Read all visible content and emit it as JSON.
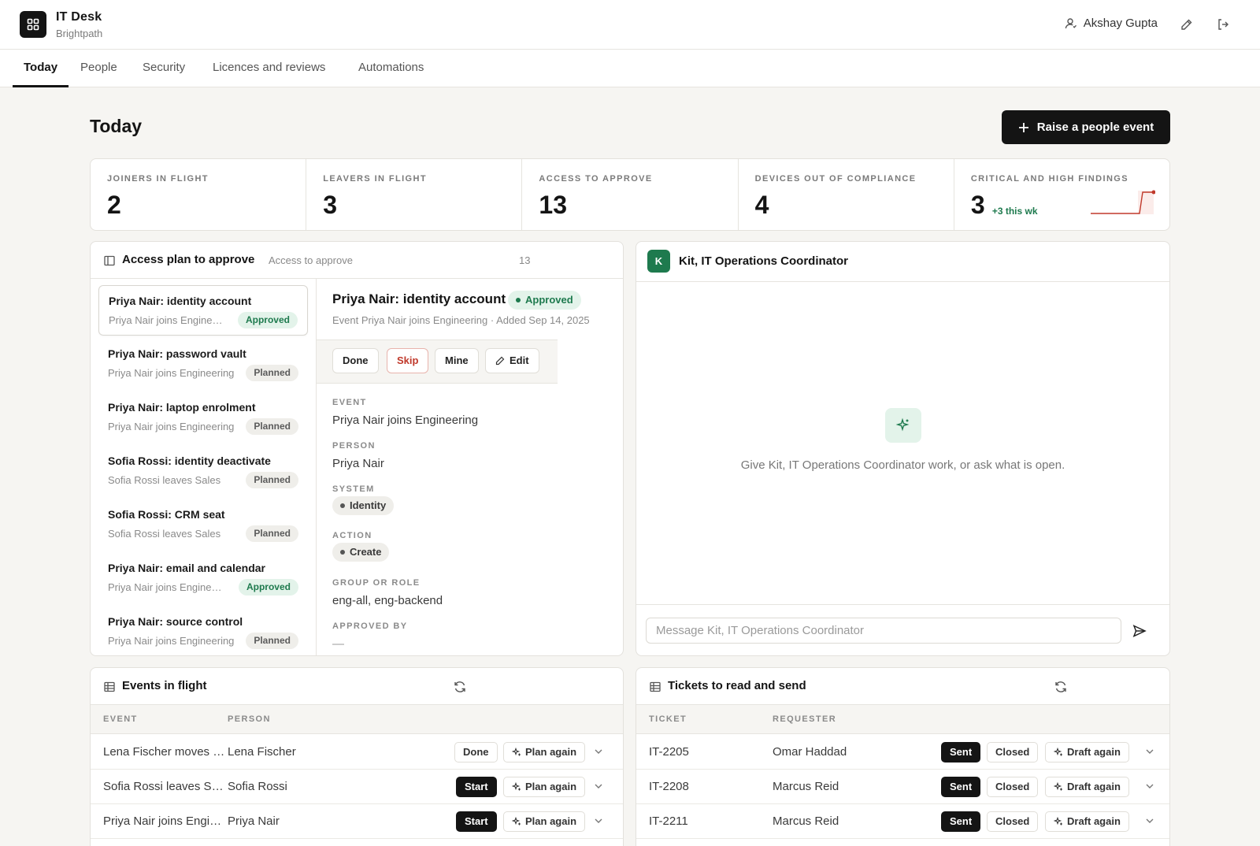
{
  "app": {
    "title": "IT Desk",
    "subtitle": "Brightpath"
  },
  "user": {
    "name": "Akshay Gupta"
  },
  "tabs": [
    {
      "label": "Today"
    },
    {
      "label": "People"
    },
    {
      "label": "Security"
    },
    {
      "label": "Licences and reviews"
    },
    {
      "label": "Automations"
    }
  ],
  "page": {
    "title": "Today",
    "primary_action": "Raise a people event"
  },
  "stats": [
    {
      "label": "JOINERS IN FLIGHT",
      "value": "2"
    },
    {
      "label": "LEAVERS IN FLIGHT",
      "value": "3"
    },
    {
      "label": "ACCESS TO APPROVE",
      "value": "13"
    },
    {
      "label": "DEVICES OUT OF COMPLIANCE",
      "value": "4"
    },
    {
      "label": "CRITICAL AND HIGH FINDINGS",
      "value": "3",
      "delta": "+3 this wk"
    }
  ],
  "access_plan": {
    "title": "Access plan to approve",
    "subtitle": "Access to approve",
    "count": "13",
    "items": [
      {
        "title": "Priya Nair: identity account",
        "sub": "Priya Nair joins Engineering",
        "status": "Approved",
        "kind": "approved"
      },
      {
        "title": "Priya Nair: password vault",
        "sub": "Priya Nair joins Engineering",
        "status": "Planned",
        "kind": "planned"
      },
      {
        "title": "Priya Nair: laptop enrolment",
        "sub": "Priya Nair joins Engineering",
        "status": "Planned",
        "kind": "planned"
      },
      {
        "title": "Sofia Rossi: identity deactivate",
        "sub": "Sofia Rossi leaves Sales",
        "status": "Planned",
        "kind": "planned"
      },
      {
        "title": "Sofia Rossi: CRM seat",
        "sub": "Sofia Rossi leaves Sales",
        "status": "Planned",
        "kind": "planned"
      },
      {
        "title": "Priya Nair: email and calendar",
        "sub": "Priya Nair joins Engineering",
        "status": "Approved",
        "kind": "approved"
      },
      {
        "title": "Priya Nair: source control",
        "sub": "Priya Nair joins Engineering",
        "status": "Planned",
        "kind": "planned"
      }
    ],
    "detail": {
      "title": "Priya Nair: identity account",
      "status": "Approved",
      "meta": "Event Priya Nair joins Engineering  ·  Added Sep 14, 2025",
      "actions": {
        "done": "Done",
        "skip": "Skip",
        "mine": "Mine",
        "edit": "Edit"
      },
      "fields": {
        "event_label": "EVENT",
        "event_value": "Priya Nair joins Engineering",
        "person_label": "PERSON",
        "person_value": "Priya Nair",
        "system_label": "SYSTEM",
        "system_value": "Identity",
        "action_label": "ACTION",
        "action_value": "Create",
        "group_label": "GROUP OR ROLE",
        "group_value": "eng-all, eng-backend",
        "approved_label": "APPROVED BY",
        "approved_value": "—"
      }
    }
  },
  "kit": {
    "avatar": "K",
    "title": "Kit, IT Operations Coordinator",
    "empty_text": "Give Kit, IT Operations Coordinator work, or ask what is open.",
    "placeholder": "Message Kit, IT Operations Coordinator"
  },
  "events": {
    "title": "Events in flight",
    "columns": [
      "EVENT",
      "PERSON"
    ],
    "rows": [
      {
        "event": "Lena Fischer moves to Finance",
        "person": "Lena Fischer",
        "action": "Done",
        "secondary": "Plan again"
      },
      {
        "event": "Sofia Rossi leaves Sales",
        "person": "Sofia Rossi",
        "action": "Start",
        "secondary": "Plan again"
      },
      {
        "event": "Priya Nair joins Engineering",
        "person": "Priya Nair",
        "action": "Start",
        "secondary": "Plan again"
      }
    ]
  },
  "tickets": {
    "title": "Tickets to read and send",
    "columns": [
      "TICKET",
      "REQUESTER"
    ],
    "rows": [
      {
        "ticket": "IT-2205",
        "requester": "Omar Haddad",
        "sent": "Sent",
        "closed": "Closed",
        "secondary": "Draft again"
      },
      {
        "ticket": "IT-2208",
        "requester": "Marcus Reid",
        "sent": "Sent",
        "closed": "Closed",
        "secondary": "Draft again"
      },
      {
        "ticket": "IT-2211",
        "requester": "Marcus Reid",
        "sent": "Sent",
        "closed": "Closed",
        "secondary": "Draft again"
      }
    ]
  },
  "colors": {
    "accent": "#141414",
    "success": "#1e7a4e",
    "danger": "#c0392b",
    "spark": "#c0392b"
  }
}
